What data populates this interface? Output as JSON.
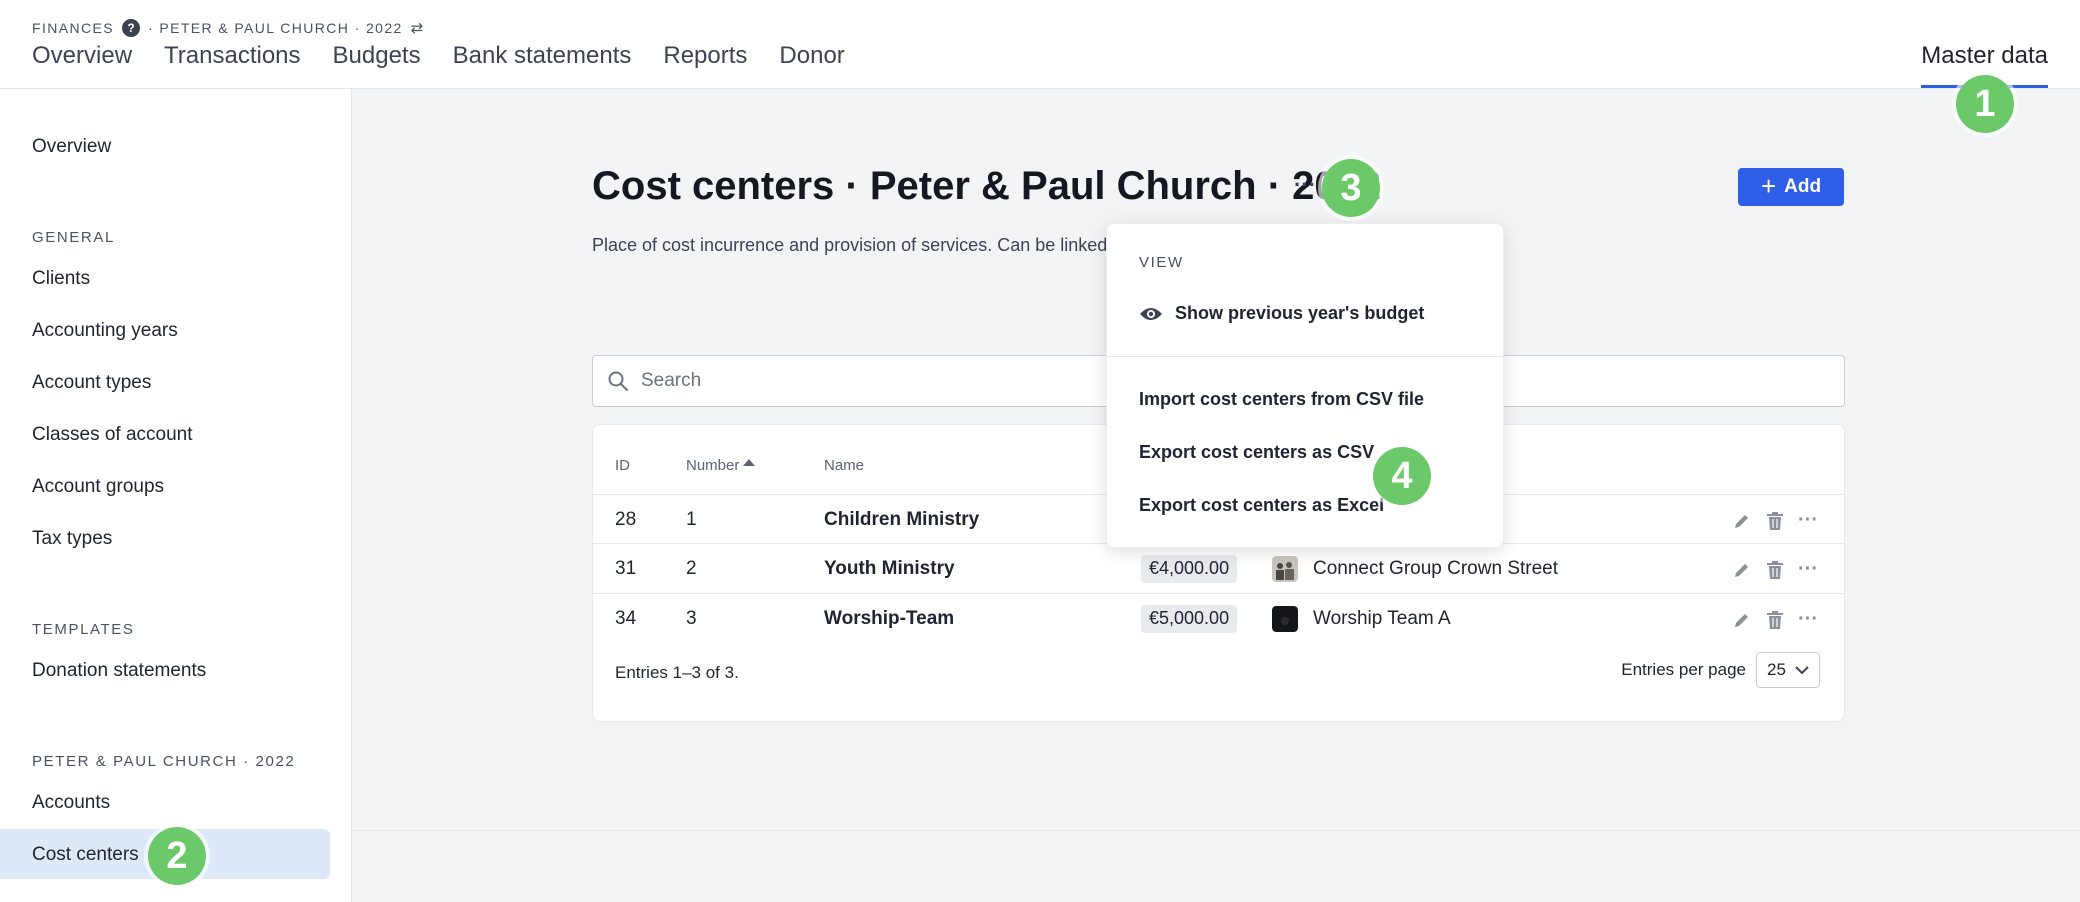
{
  "header": {
    "crumb_section": "FINANCES",
    "crumb_help": "?",
    "crumb_context": "· PETER & PAUL CHURCH · 2022",
    "nav": [
      "Overview",
      "Transactions",
      "Budgets",
      "Bank statements",
      "Reports",
      "Donor"
    ],
    "nav_right": "Master data"
  },
  "sidebar": {
    "overview": "Overview",
    "general_heading": "GENERAL",
    "general_items": [
      "Clients",
      "Accounting years",
      "Account types",
      "Classes of account",
      "Account groups",
      "Tax types"
    ],
    "templates_heading": "TEMPLATES",
    "templates_items": [
      "Donation statements"
    ],
    "context_heading": "PETER & PAUL CHURCH · 2022",
    "context_items": [
      "Accounts",
      "Cost centers"
    ]
  },
  "main": {
    "title": "Cost centers · Peter & Paul Church · 2022",
    "more": "···",
    "subtitle": "Place of cost incurrence and provision of services. Can be linked",
    "add_label": "Add",
    "search_placeholder": "Search"
  },
  "table": {
    "headers": {
      "id": "ID",
      "number": "Number",
      "name": "Name"
    },
    "rows": [
      {
        "id": "28",
        "number": "1",
        "name": "Children Ministry",
        "budget": "",
        "group": ""
      },
      {
        "id": "31",
        "number": "2",
        "name": "Youth Ministry",
        "budget": "€4,000.00",
        "group": "Connect Group Crown Street"
      },
      {
        "id": "34",
        "number": "3",
        "name": "Worship-Team",
        "budget": "€5,000.00",
        "group": "Worship Team A"
      }
    ],
    "entries_text": "Entries 1–3 of 3.",
    "per_page_label": "Entries per page",
    "per_page_value": "25"
  },
  "dropdown": {
    "view_heading": "VIEW",
    "show_prev": "Show previous year's budget",
    "import_csv": "Import cost centers from CSV file",
    "export_csv": "Export cost centers as CSV",
    "export_excel": "Export cost centers as Excel"
  },
  "badges": {
    "b1": "1",
    "b2": "2",
    "b3": "3",
    "b4": "4"
  },
  "colors": {
    "accent": "#2f5ee8",
    "badge": "#6cc96a",
    "active_bg": "#dde8f8"
  }
}
